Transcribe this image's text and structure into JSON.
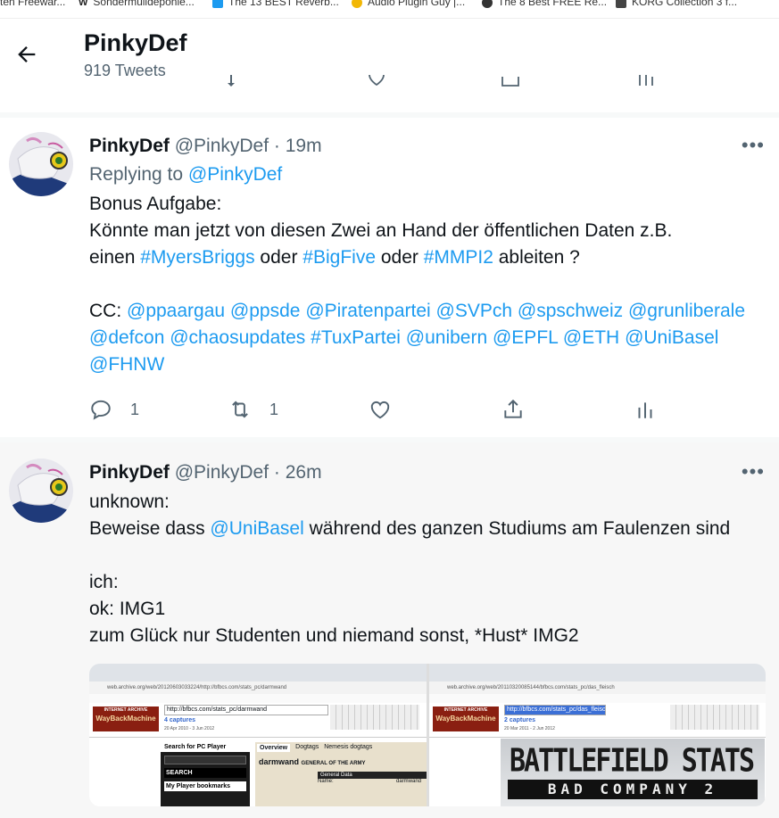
{
  "bookmarks": [
    {
      "label": "ten Freewar...",
      "color": "#555555"
    },
    {
      "label": "Sondermülldeponie...",
      "color": "#222222"
    },
    {
      "label": "The 13 BEST Reverb...",
      "color": "#1d9bf0"
    },
    {
      "label": "Audio Plugin Guy |...",
      "color": "#f2b705"
    },
    {
      "label": "The 8 Best FREE Re...",
      "color": "#333333"
    },
    {
      "label": "KORG Collection 3 f...",
      "color": "#444444"
    }
  ],
  "header": {
    "title": "PinkyDef",
    "subtitle": "919 Tweets"
  },
  "colors": {
    "link": "#1d9bf0",
    "muted": "#536471",
    "text": "#0f1419"
  },
  "tweets": [
    {
      "name": "PinkyDef",
      "handle": "@PinkyDef",
      "time": "· 19m",
      "replying_prefix": "Replying to ",
      "replying_to": "@PinkyDef",
      "line1": "Bonus Aufgabe:",
      "line2": "Könnte man jetzt von diesen Zwei an Hand der öffentlichen Daten z.B.",
      "line3_a": "einen ",
      "tag_mb": "#MyersBriggs",
      "line3_b": " oder ",
      "tag_bf": "#BigFive",
      "line3_c": " oder ",
      "tag_mmpi": "#MMPI2",
      "line3_d": " ableiten ?",
      "cc_label": "CC: ",
      "mentions": [
        "@ppaargau",
        "@ppsde",
        "@Piratenpartei",
        "@SVPch",
        "@spschweiz",
        "@grunliberale",
        "@defcon",
        "@chaosupdates",
        "#TuxPartei",
        "@unibern",
        "@EPFL",
        "@ETH",
        "@UniBasel",
        "@FHNW"
      ],
      "reply_count": "1",
      "retweet_count": "1",
      "like_count": "",
      "share_label": ""
    },
    {
      "name": "PinkyDef",
      "handle": "@PinkyDef",
      "time": "· 26m",
      "line1": "unknown:",
      "line2_a": "Beweise dass ",
      "mention": "@UniBasel",
      "line2_b": " während des ganzen Studiums am Faulenzen sind",
      "line3": "ich:",
      "line4": "ok: IMG1",
      "line5": "zum Glück nur Studenten und niemand sonst, *Hust* IMG2",
      "image1": {
        "address": "web.archive.org/web/20120603033224/http://bfbcs.com/stats_pc/darmwand",
        "logo_top": "INTERNET ARCHIVE",
        "logo": "WayBackMachine",
        "url": "http://bfbcs.com/stats_pc/darmwand",
        "captures": "4 captures",
        "dates": "20 Apr 2010 - 3 Jun 2012",
        "side_label": "Search for PC Player",
        "search_btn": "SEARCH",
        "bookmarks": "My Player bookmarks",
        "tab1": "Overview",
        "tab2": "Dogtags",
        "tab3": "Nemesis dogtags",
        "player": "darmwand",
        "rank": "GENERAL OF THE ARMY",
        "section": "General Data",
        "field": "Name:",
        "field_value": "darmwand"
      },
      "image2": {
        "address": "web.archive.org/web/20110320085144/bfbcs.com/stats_pc/das_fleisch",
        "logo_top": "INTERNET ARCHIVE",
        "logo": "WayBackMachine",
        "url": "http://bfbcs.com/stats_pc/das_fleisch",
        "captures": "2 captures",
        "dates": "20 Mar 2011 - 2 Jun 2012",
        "title": "BATTLEFIELD STATS",
        "subtitle": "BAD COMPANY 2"
      }
    }
  ]
}
